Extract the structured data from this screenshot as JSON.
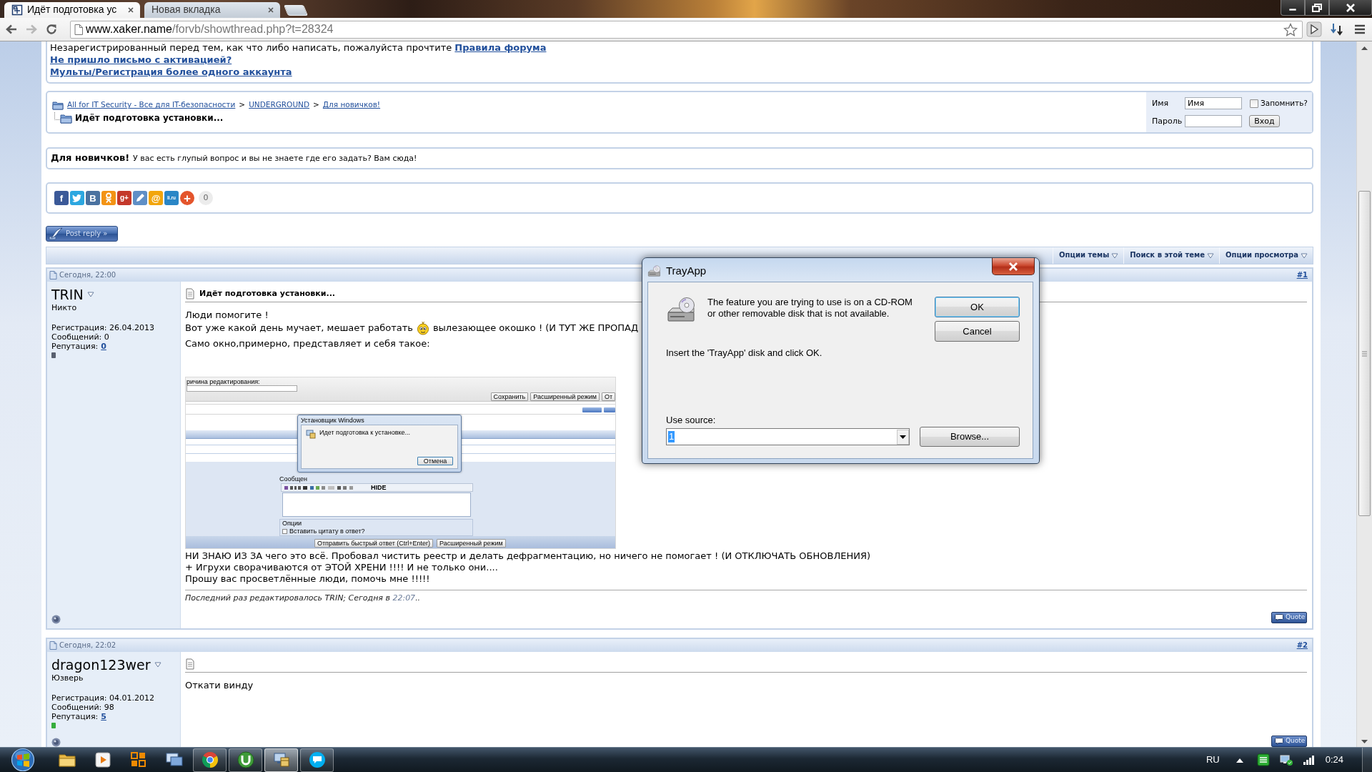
{
  "browser": {
    "tabs": [
      {
        "title": "Идёт подготовка ус",
        "favicon": true,
        "selected": true
      },
      {
        "title": "Новая вкладка",
        "favicon": false,
        "selected": false
      }
    ],
    "back_disabled": false,
    "forward_disabled": true,
    "address": {
      "host": "www.xaker.name",
      "path": "/forvb/showthread.php?t=28324"
    }
  },
  "notice": {
    "text": "Незарегистрированный перед тем, как что либо написать, пожалуйста прочтите",
    "rules_link": "Правила форума",
    "links": [
      "Не пришло письмо с активацией?",
      "Мульты/Регистрация более одного аккаунта"
    ]
  },
  "navbar": {
    "breadcrumb": [
      {
        "label": "All for IT Security - Все для IT-безопасности",
        "separator": ">"
      },
      {
        "label": "UNDERGROUND",
        "separator": ">"
      },
      {
        "label": "Для новичков!"
      }
    ],
    "current": "Идёт подготовка установки..."
  },
  "login": {
    "username_label": "Имя",
    "username_value": "Имя",
    "remember_label": "Запомнить?",
    "remember_checked": false,
    "password_label": "Пароль",
    "submit": "Вход"
  },
  "forum_info": {
    "title": "Для новичков!",
    "description": "У вас есть глупый вопрос и вы не знаете где его задать? Вам сюда!"
  },
  "share": {
    "buttons": [
      {
        "kind": "letter",
        "glyph": "f",
        "color": "#3b5998"
      },
      {
        "kind": "bird",
        "color": "#2ca7e0"
      },
      {
        "kind": "letter",
        "glyph": "B",
        "color": "#4a72a0"
      },
      {
        "kind": "figure",
        "color": "#f39314"
      },
      {
        "kind": "letter",
        "glyph": "g+",
        "color": "#c4382a"
      },
      {
        "kind": "pen",
        "color": "#5f8fc6"
      },
      {
        "kind": "letter",
        "glyph": "@",
        "color": "#f2a50c"
      },
      {
        "kind": "letter",
        "glyph": "li.ru",
        "color": "#2a86c6"
      },
      {
        "kind": "round",
        "glyph": "+",
        "color": "#e4552c"
      }
    ],
    "count": "0"
  },
  "post_reply": "Post reply »",
  "thread_tools": [
    {
      "label": "Опции темы"
    },
    {
      "label": "Поиск в этой теме"
    },
    {
      "label": "Опции просмотра"
    }
  ],
  "posts": [
    {
      "date": "Сегодня, 22:00",
      "number": "#1",
      "user": {
        "name": "TRIN",
        "rank": "Никто",
        "registered": "Регистрация: 26.04.2013",
        "post_count": "Сообщений: 0",
        "reputation_label": "Репутация:",
        "reputation": "0",
        "color": "#59606f"
      },
      "subject": "Идёт подготовка установки...",
      "body": [
        {
          "kind": "text",
          "text": "Люди помогите !"
        },
        {
          "kind": "emoji_line",
          "before": "Вот уже какой день мучает, мешает работать",
          "after": "вылезающее окошко ! (И ТУТ ЖЕ ПРОПАД"
        },
        {
          "kind": "text",
          "text": "Само окно,примерно, представляет и себя такое:"
        },
        {
          "kind": "screenshot",
          "edit_reason_label": "ричина редактирования:",
          "top_buttons": [
            "Сохранить",
            "Расширенный режим",
            "От"
          ],
          "dialog": {
            "title": "Установщик Windows",
            "message": "Идет подготовка к установке...",
            "button": "Отмена"
          },
          "message_label": "Сообщен",
          "editor_label": "HIDE",
          "options_label": "Опции",
          "quote_option": "Вставить цитату в ответ?",
          "quote_checked": false,
          "bottom_buttons": [
            "Отправить быстрый ответ (Ctrl+Enter)",
            "Расширенный режим"
          ]
        },
        {
          "kind": "text",
          "text": "НИ ЗНАЮ ИЗ ЗА чего это всё. Пробовал чистить реестр и делать дефрагментацию, но ничего не помогает ! (И ОТКЛЮЧАТЬ ОБНОВЛЕНИЯ)"
        },
        {
          "kind": "text",
          "text": "+ Игрухи сворачиваются от ЭТОЙ ХРЕНИ !!!! И не только они...."
        },
        {
          "kind": "text",
          "text": "Прошу вас просветлённые люди, помочь мне !!!!!"
        }
      ],
      "edited": {
        "text": "Последний раз редактировалось TRIN; Сегодня в",
        "time": "22:07",
        "tail": ".."
      },
      "quote": "Quote"
    },
    {
      "date": "Сегодня, 22:02",
      "number": "#2",
      "user": {
        "name": "dragon123wer",
        "rank": "Юзверь",
        "registered": "Регистрация: 04.01.2012",
        "post_count": "Сообщений: 98",
        "reputation_label": "Репутация:",
        "reputation": "5",
        "color": "#36ad3c"
      },
      "body": [
        {
          "kind": "text",
          "text": "Откати винду"
        }
      ],
      "quote": "Quote"
    }
  ],
  "dialog": {
    "title": "TrayApp",
    "message": "The feature you are trying to use is on a CD-ROM or other removable disk that is not available.",
    "buttons": [
      {
        "label": "OK",
        "default": true
      },
      {
        "label": "Cancel",
        "default": false
      }
    ],
    "instruction": "Insert the 'TrayApp' disk and click OK.",
    "source_label": "Use source:",
    "source_value": "1",
    "source_selected": true,
    "browse": "Browse..."
  },
  "taskbar": {
    "items": [
      {
        "kind": "folder",
        "running": false,
        "selected": false
      },
      {
        "kind": "player",
        "running": false,
        "selected": false
      },
      {
        "kind": "tiles",
        "running": false,
        "selected": false
      },
      {
        "kind": "windows",
        "running": false,
        "selected": false
      },
      {
        "kind": "browser",
        "running": true,
        "selected": false
      },
      {
        "kind": "torrent",
        "running": true,
        "selected": false
      },
      {
        "kind": "installer",
        "running": true,
        "selected": true
      },
      {
        "kind": "chat",
        "running": true,
        "selected": false
      }
    ],
    "language": "RU",
    "clock": "0:24"
  }
}
